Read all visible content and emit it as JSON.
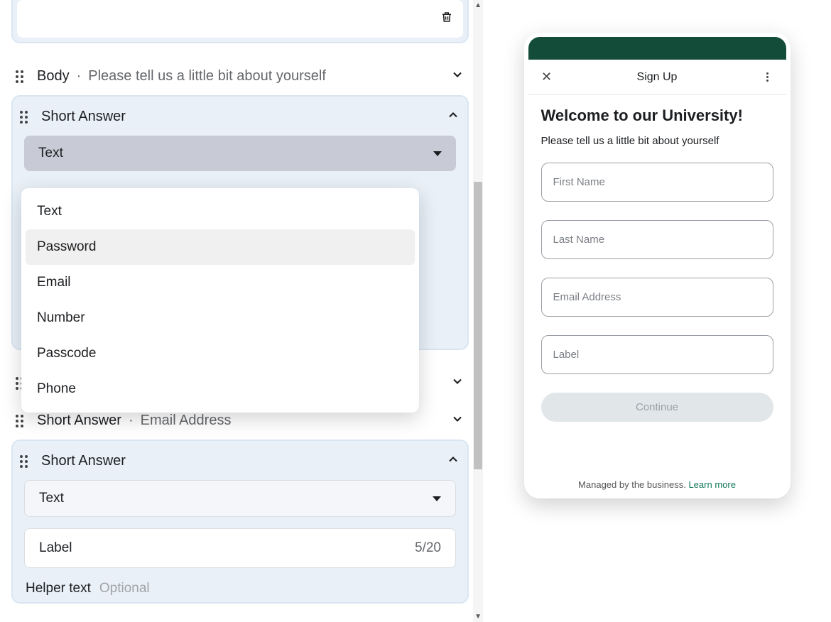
{
  "builder": {
    "body_row": {
      "title": "Body",
      "subtitle": "Please tell us a little bit about yourself"
    },
    "short_answer_expanded_1": {
      "title": "Short Answer",
      "select_label": "Text",
      "options": [
        "Text",
        "Password",
        "Email",
        "Number",
        "Passcode",
        "Phone"
      ]
    },
    "collapsed_rows": [
      {
        "title": "Short Answer",
        "subtitle": "Email Address"
      }
    ],
    "short_answer_expanded_2": {
      "title": "Short Answer",
      "select_label": "Text",
      "label_input": "Label",
      "char_count": "5/20",
      "helper_label": "Helper text",
      "helper_optional": "Optional"
    }
  },
  "preview": {
    "top_title": "Sign Up",
    "welcome": "Welcome to our University!",
    "subtitle": "Please tell us a little bit about yourself",
    "fields": [
      "First Name",
      "Last Name",
      "Email Address",
      "Label"
    ],
    "cta": "Continue",
    "footer_text": "Managed by the business.",
    "footer_link": "Learn more"
  }
}
